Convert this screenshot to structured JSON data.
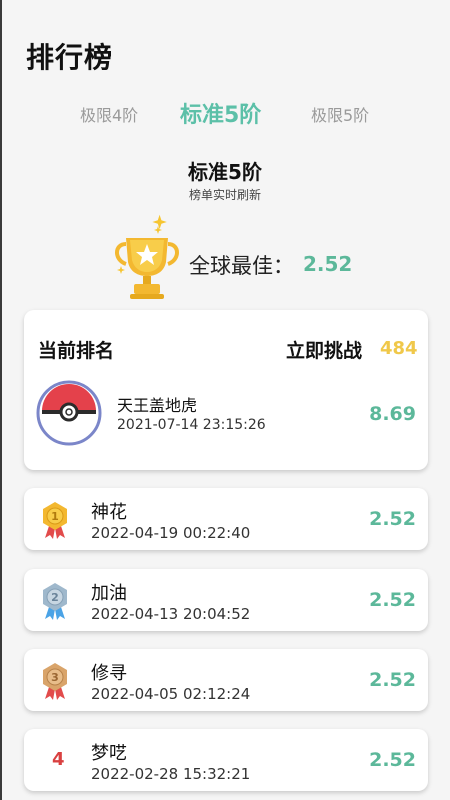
{
  "header": {
    "title": "排行榜"
  },
  "tabs": [
    {
      "label": "极限4阶",
      "active": false
    },
    {
      "label": "标准5阶",
      "active": true
    },
    {
      "label": "极限5阶",
      "active": false
    }
  ],
  "section": {
    "title": "标准5阶",
    "caption": "榜单实时刷新",
    "best_label": "全球最佳：",
    "best_value": "2.52"
  },
  "current": {
    "title": "当前排名",
    "challenge_label": "立即挑战",
    "challenge_count": "484",
    "user": {
      "name": "天王盖地虎",
      "time": "2021-07-14 23:15:26",
      "score": "8.69"
    }
  },
  "ranking": [
    {
      "rank": "1",
      "name": "神花",
      "time": "2022-04-19 00:22:40",
      "score": "2.52",
      "medal": "gold"
    },
    {
      "rank": "2",
      "name": "加油",
      "time": "2022-04-13 20:04:52",
      "score": "2.52",
      "medal": "silver"
    },
    {
      "rank": "3",
      "name": "修寻",
      "time": "2022-04-05 02:12:24",
      "score": "2.52",
      "medal": "bronze"
    },
    {
      "rank": "4",
      "name": "梦呓",
      "time": "2022-02-28 15:32:21",
      "score": "2.52",
      "medal": "none"
    }
  ],
  "colors": {
    "accent": "#5cc0a8",
    "score": "#5cb89a",
    "challenge_count": "#f0c84a",
    "rank_number": "#d94040",
    "gold": "#f3b830",
    "silver": "#9fb8cc",
    "bronze": "#d9a46a"
  },
  "icons": {
    "trophy": "trophy-icon",
    "avatar": "pokeball-avatar",
    "medals": [
      "gold-medal-icon",
      "silver-medal-icon",
      "bronze-medal-icon"
    ]
  }
}
